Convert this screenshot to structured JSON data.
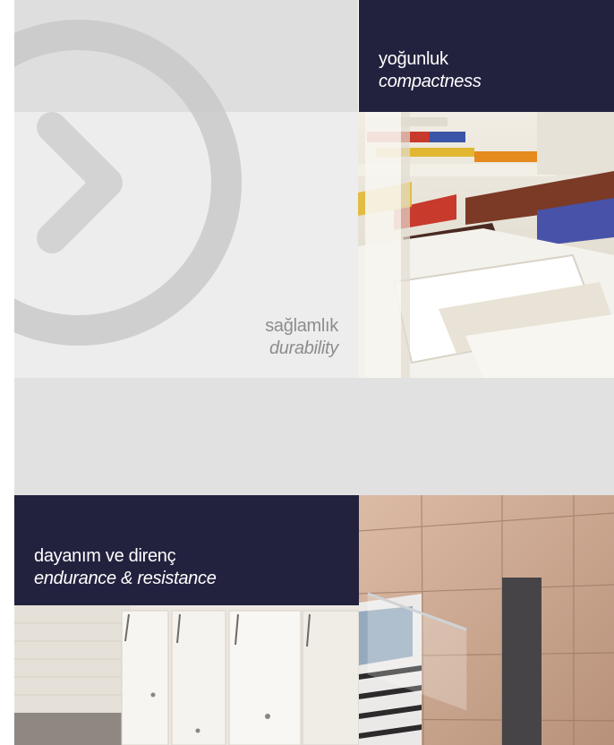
{
  "blocks": {
    "durability": {
      "tr": "sağlamlık",
      "en": "durability"
    },
    "compactness": {
      "tr": "yoğunluk",
      "en": "compactness"
    },
    "endurance": {
      "tr": "dayanım ve direnç",
      "en": "endurance & resistance"
    }
  },
  "icons": {
    "logo": "circle-chevron-right-icon"
  },
  "colors": {
    "navy": "#22223f",
    "light_grey": "#ededed",
    "mid_grey": "#e1e1e1",
    "label_grey": "#8d8d8d"
  }
}
